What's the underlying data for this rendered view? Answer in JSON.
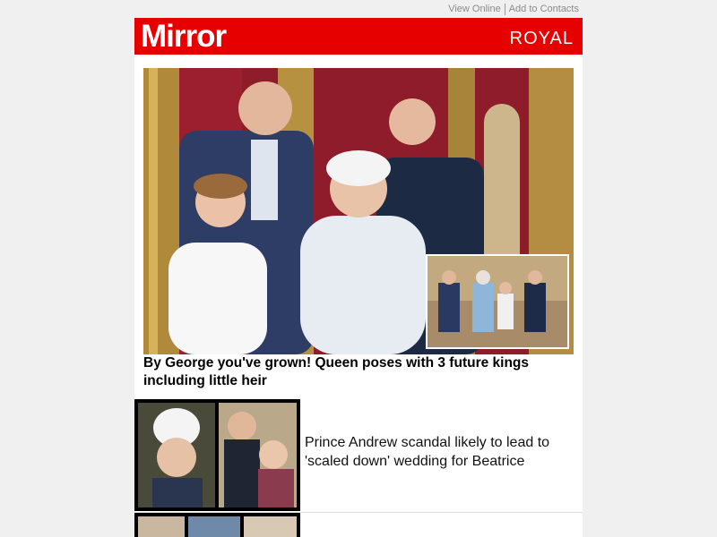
{
  "header_links": {
    "view_online": "View Online",
    "add_contacts": "Add to Contacts"
  },
  "masthead": {
    "logo": "Mirror",
    "section": "ROYAL"
  },
  "featured": {
    "headline": "By George you've grown! Queen poses with 3 future kings including little heir"
  },
  "stories": [
    {
      "title": "Prince Andrew scandal likely to lead to 'scaled down' wedding for Beatrice"
    }
  ],
  "colors": {
    "brand_red": "#e60000",
    "page_bg": "#f0f0f0"
  }
}
